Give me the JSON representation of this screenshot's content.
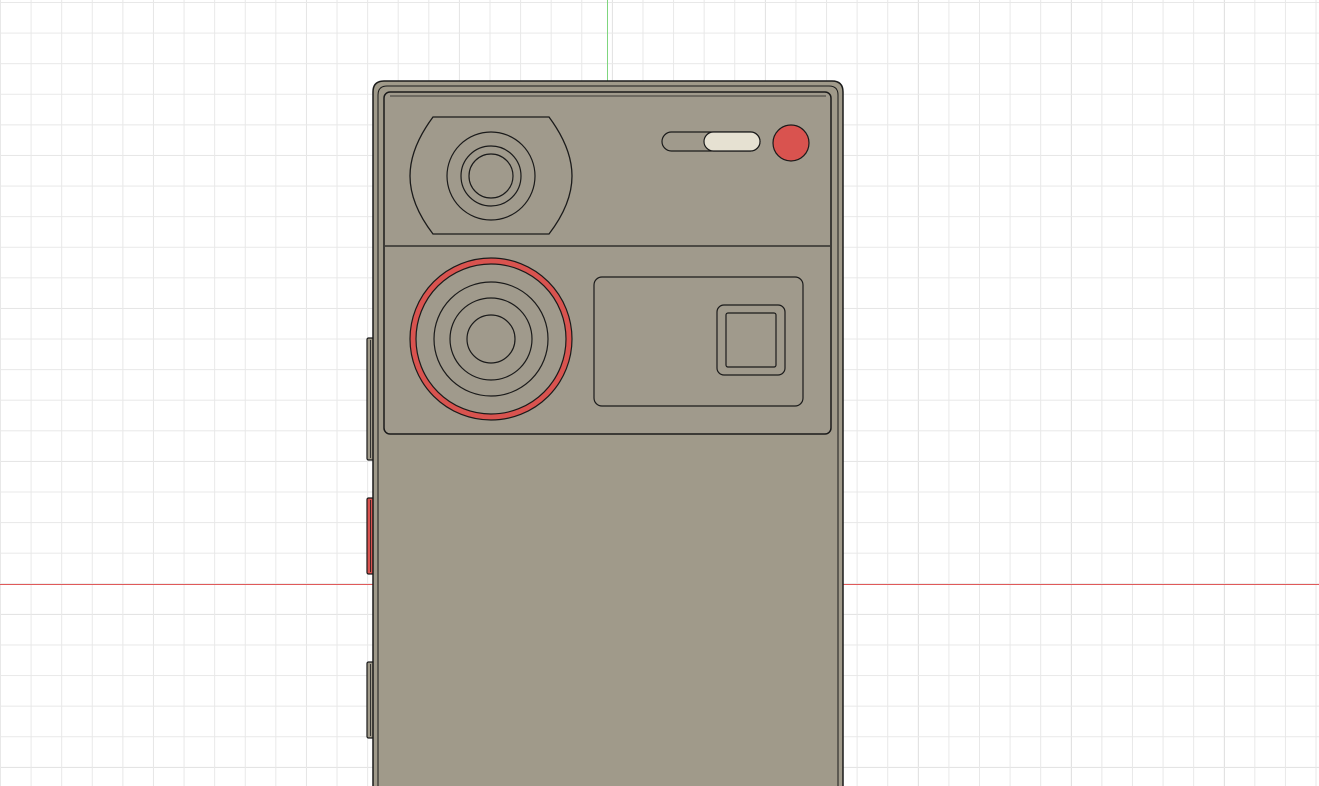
{
  "viewport": {
    "background": "#ffffff",
    "grid_minor_color": "#e8e8e8",
    "grid_major_color": "#d0d0d0",
    "x_axis_color": "#e05a5a",
    "y_axis_color": "#7fd67f"
  },
  "model": {
    "body_color": "#a09a8a",
    "module_color": "#a09a8c",
    "outline_color": "#1a1a1a",
    "accent_red": "#d9534f",
    "slider_thumb_color": "#e6e1d2"
  }
}
